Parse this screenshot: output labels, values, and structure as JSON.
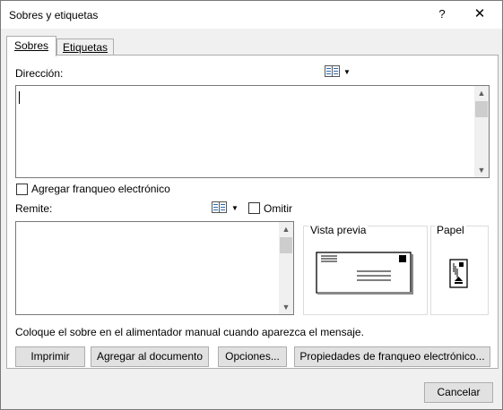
{
  "window": {
    "title": "Sobres y etiquetas",
    "help": "?",
    "close": "✕"
  },
  "tabs": [
    {
      "label": "Sobres",
      "active": true
    },
    {
      "label": "Etiquetas",
      "active": false
    }
  ],
  "address": {
    "label": "Dirección:",
    "value": ""
  },
  "electronic_postage": {
    "label": "Agregar franqueo electrónico",
    "checked": false
  },
  "return_address": {
    "label": "Remite:",
    "value": "",
    "omit_label": "Omitir",
    "omit_checked": false
  },
  "preview": {
    "label": "Vista previa"
  },
  "feed": {
    "label": "Papel"
  },
  "message": "Coloque el sobre en el alimentador manual cuando aparezca el mensaje.",
  "buttons": {
    "print": "Imprimir",
    "add_to_document": "Agregar al documento",
    "options": "Opciones...",
    "postage_properties": "Propiedades de franqueo electrónico...",
    "cancel": "Cancelar"
  }
}
